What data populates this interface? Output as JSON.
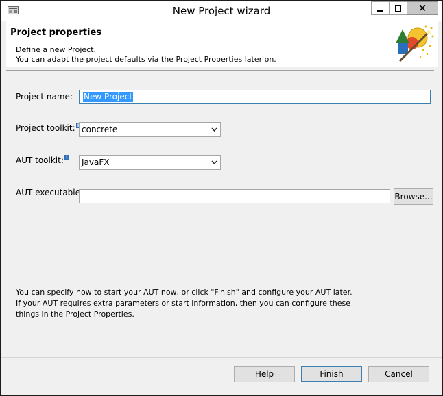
{
  "window": {
    "title": "New Project wizard",
    "close_glyph": "✕"
  },
  "banner": {
    "title": "Project properties",
    "line1": "Define a new Project.",
    "line2": "You can adapt the project defaults via the Project Properties later on."
  },
  "form": {
    "project_name_label": "Project name:",
    "project_name_value": "New Project",
    "project_toolkit_label": "Project toolkit:",
    "project_toolkit_value": "concrete",
    "aut_toolkit_label": "AUT toolkit:",
    "aut_toolkit_value": "JavaFX",
    "aut_executable_label": "AUT executable:",
    "aut_executable_value": "",
    "browse_label": "Browse...",
    "info_glyph": "i"
  },
  "hint": {
    "line1": "You can specify how to start your AUT now, or click \"Finish\" and configure your AUT later.",
    "line2": "If your AUT requires extra parameters or start information, then you can configure these",
    "line3": "things in the Project Properties."
  },
  "buttons": {
    "help_mnemonic": "H",
    "help_rest": "elp",
    "finish_mnemonic": "F",
    "finish_rest": "inish",
    "cancel_label": "Cancel"
  },
  "colors": {
    "selection": "#3399ff",
    "focus_border": "#3c7fb1",
    "info_icon": "#2e6fb8"
  },
  "icons": {
    "app": "app-window-icon",
    "wizard_art": "wizard-art-icon",
    "info": "info-icon",
    "dropdown": "chevron-down-icon"
  }
}
